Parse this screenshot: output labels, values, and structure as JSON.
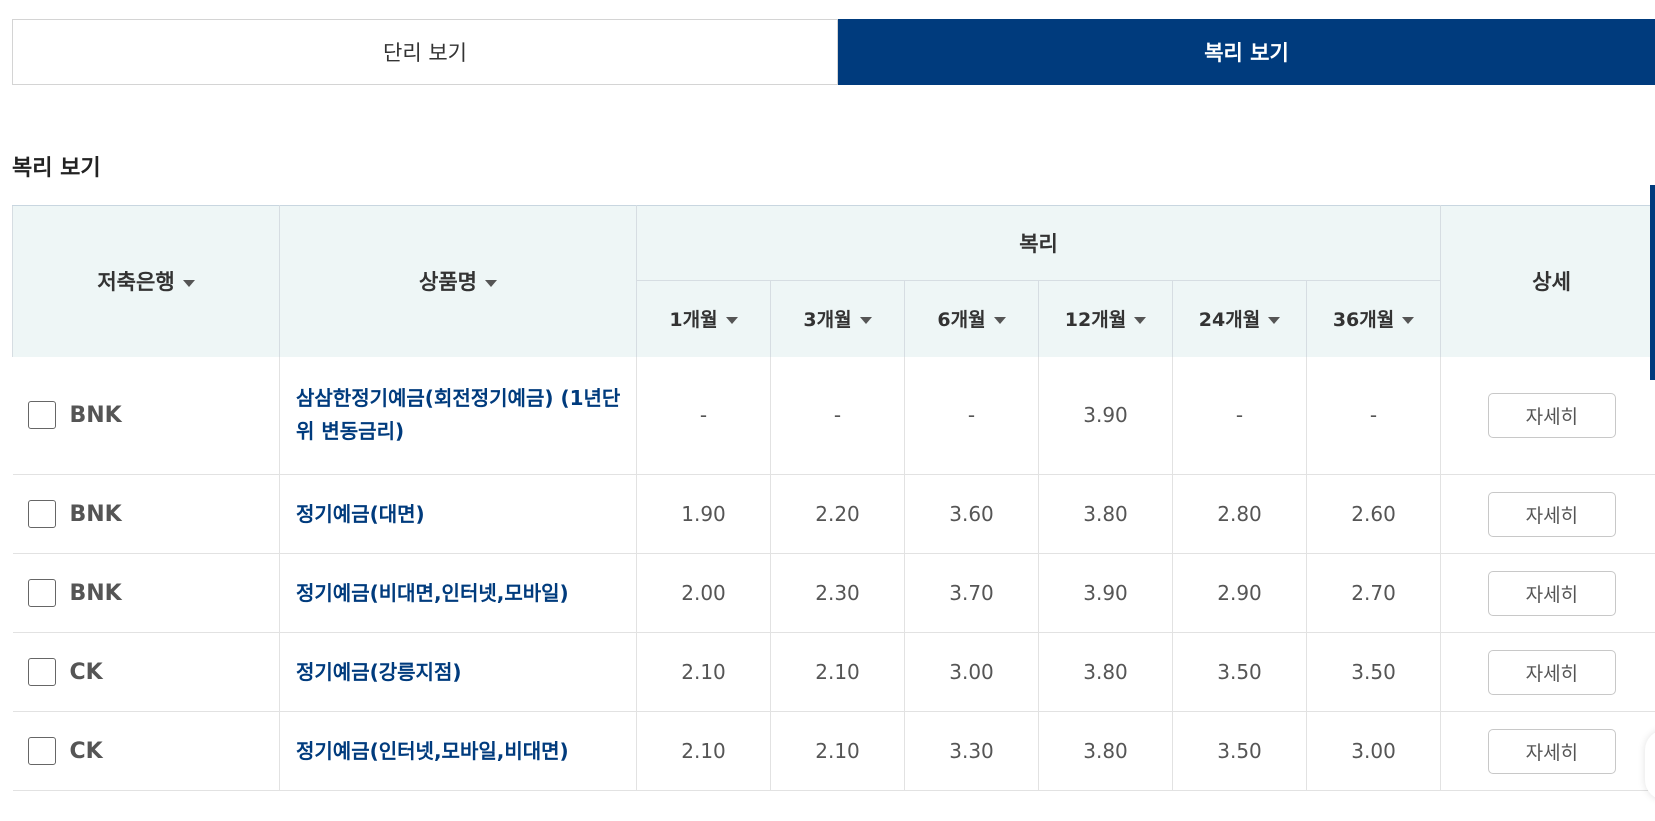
{
  "tabs": {
    "simple_label": "단리 보기",
    "compound_label": "복리 보기"
  },
  "section_title": "복리 보기",
  "table": {
    "headers": {
      "bank": "저축은행",
      "product": "상품명",
      "group": "복리",
      "detail": "상세",
      "terms": [
        "1개월",
        "3개월",
        "6개월",
        "12개월",
        "24개월",
        "36개월"
      ]
    },
    "rows": [
      {
        "bank": "BNK",
        "product": "삼삼한정기예금(회전정기예금) (1년단위 변동금리)",
        "rates": [
          "-",
          "-",
          "-",
          "3.90",
          "-",
          "-"
        ],
        "detail_label": "자세히"
      },
      {
        "bank": "BNK",
        "product": "정기예금(대면)",
        "rates": [
          "1.90",
          "2.20",
          "3.60",
          "3.80",
          "2.80",
          "2.60"
        ],
        "detail_label": "자세히"
      },
      {
        "bank": "BNK",
        "product": "정기예금(비대면,인터넷,모바일)",
        "rates": [
          "2.00",
          "2.30",
          "3.70",
          "3.90",
          "2.90",
          "2.70"
        ],
        "detail_label": "자세히"
      },
      {
        "bank": "CK",
        "product": "정기예금(강릉지점)",
        "rates": [
          "2.10",
          "2.10",
          "3.00",
          "3.80",
          "3.50",
          "3.50"
        ],
        "detail_label": "자세히"
      },
      {
        "bank": "CK",
        "product": "정기예금(인터넷,모바일,비대면)",
        "rates": [
          "2.10",
          "2.10",
          "3.30",
          "3.80",
          "3.50",
          "3.00"
        ],
        "detail_label": "자세히"
      }
    ]
  },
  "colors": {
    "primary": "#003b7d",
    "header_bg": "#eef6f6",
    "border": "#e2e2e2"
  }
}
